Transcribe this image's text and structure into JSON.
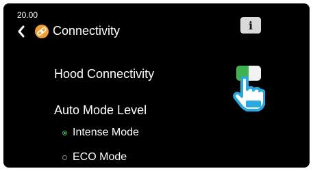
{
  "status": {
    "time": "20.00"
  },
  "header": {
    "back_icon": "chevron-left-icon",
    "app_icon": "link-icon",
    "title": "Connectivity",
    "info_label": "i"
  },
  "settings": {
    "hood_connectivity": {
      "label": "Hood Connectivity",
      "enabled": true,
      "on_fraction": 0.5
    },
    "auto_mode": {
      "label": "Auto Mode Level",
      "options": [
        {
          "label": "Intense Mode",
          "selected": true
        },
        {
          "label": "ECO Mode",
          "selected": false
        }
      ]
    }
  },
  "overlay": {
    "icon": "tap-hand-icon"
  },
  "colors": {
    "background": "#000000",
    "accent_green": "#3fb24f",
    "app_icon": "#f0a030",
    "info_button": "#d9d9d9",
    "hand": "#2aa8e0"
  }
}
